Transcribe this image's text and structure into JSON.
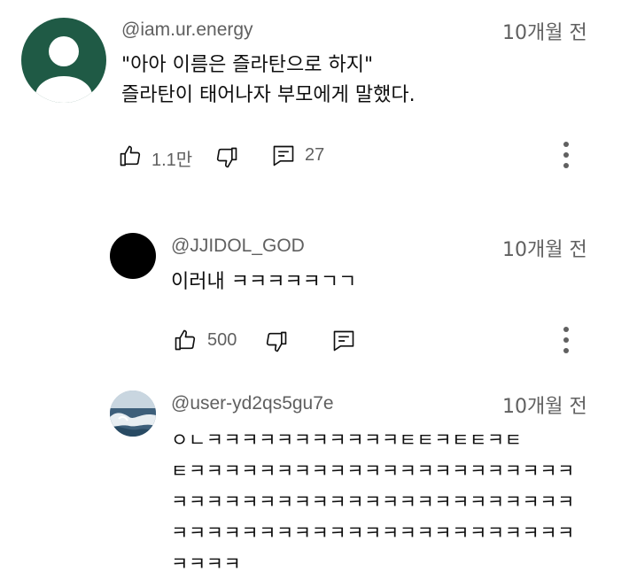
{
  "comments": [
    {
      "handle": "@iam.ur.energy",
      "time": "10개월 전",
      "lines": [
        "\"아아 이름은 즐라탄으로 하지\"",
        "즐라탄이 태어나자 부모에게 말했다."
      ],
      "likes": "1.1만",
      "replies": "27",
      "avatar": "default-silhouette",
      "avatar_color": "#1f5a45"
    },
    {
      "handle": "@JJIDOL_GOD",
      "time": "10개월 전",
      "lines": [
        "이러내 ㅋㅋㅋㅋㅋㄱㄱ"
      ],
      "likes": "500",
      "avatar": "black-circle",
      "avatar_color": "#000000"
    },
    {
      "handle": "@user-yd2qs5gu7e",
      "time": "10개월 전",
      "lines": [
        "ㅇㄴㅋㅋㅋㅋㅋㅋㅋㅋㅋㅋㅋㅌㅌㅋㅌㅌㅋㅌ",
        "ㅌㅋㅋㅋㅋㅋㅋㅋㅋㅋㅋㅋㅋㅋㅋㅋㅋㅋㅋㅋㅋㅋㅋ",
        "ㅋㅋㅋㅋㅋㅋㅋㅋㅋㅋㅋㅋㅋㅋㅋㅋㅋㅋㅋㅋㅋㅋㅋ",
        "ㅋㅋㅋㅋㅋㅋㅋㅋㅋㅋㅋㅋㅋㅋㅋㅋㅋㅋㅋㅋㅋㅋㅋ",
        "ㅋㅋㅋㅋ"
      ],
      "avatar": "ocean-wave-photo"
    }
  ],
  "icons": {
    "like": "thumbs-up-icon",
    "dislike": "thumbs-down-icon",
    "reply": "comment-icon",
    "more": "more-vert-icon"
  }
}
